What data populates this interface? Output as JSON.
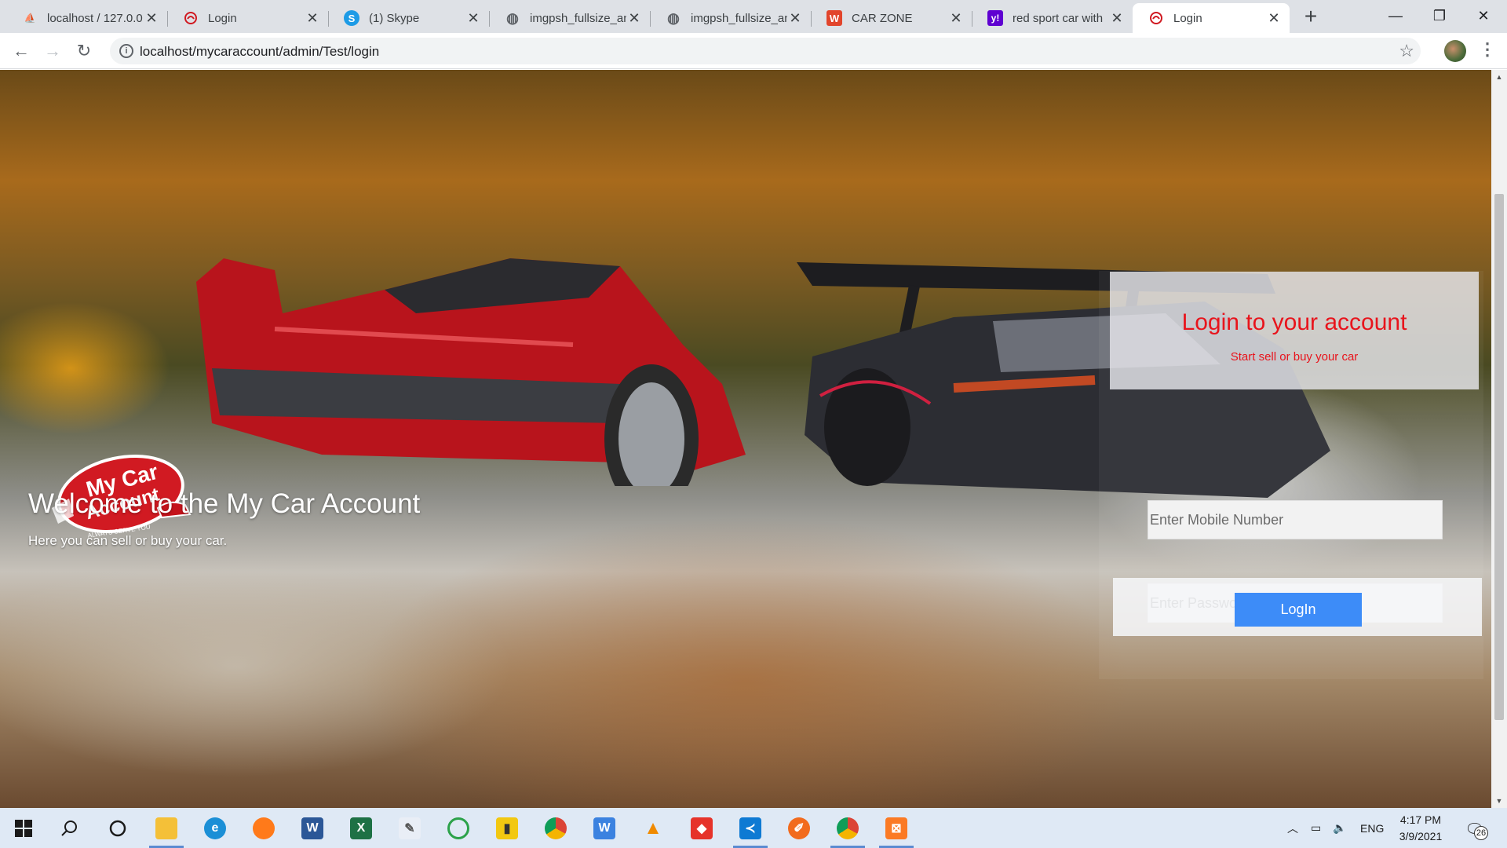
{
  "browser": {
    "tabs": [
      {
        "title": "localhost / 127.0.0",
        "favicon": "phpmyadmin-icon"
      },
      {
        "title": "Login",
        "favicon": "car-logo-icon"
      },
      {
        "title": "(1) Skype",
        "favicon": "skype-icon"
      },
      {
        "title": "imgpsh_fullsize_an",
        "favicon": "globe-icon"
      },
      {
        "title": "imgpsh_fullsize_an",
        "favicon": "globe-icon"
      },
      {
        "title": "CAR ZONE",
        "favicon": "w-brand-icon"
      },
      {
        "title": "red sport car with",
        "favicon": "yahoo-icon"
      },
      {
        "title": "Login",
        "favicon": "car-logo-icon",
        "active": true
      }
    ],
    "address": "localhost/mycaraccount/admin/Test/login"
  },
  "page": {
    "logo": {
      "line1": "My Car",
      "line2": "Account",
      "tagline": "ALWAYS SERVE YOU"
    },
    "welcome_title": "Welcome to the My Car Account",
    "welcome_subtitle": "Here you can sell or buy your car.",
    "login": {
      "title": "Login to your account",
      "subtitle": "Start sell or buy your car",
      "mobile_placeholder": "Enter Mobile Number",
      "password_placeholder": "Enter Password",
      "button_label": "LogIn"
    }
  },
  "taskbar": {
    "apps": [
      "start-icon",
      "search-icon",
      "cortana-icon",
      "file-explorer-icon",
      "edge-icon",
      "firefox-icon",
      "word-icon",
      "excel-icon",
      "paint-icon",
      "sync-icon",
      "powerbi-icon",
      "chrome-icon",
      "writer-icon",
      "vlc-icon",
      "anydesk-icon",
      "vscode-icon",
      "pen-icon",
      "chrome-profile-icon",
      "xampp-icon"
    ],
    "language": "ENG",
    "time": "4:17 PM",
    "date": "3/9/2021",
    "notifications": "26"
  },
  "colors": {
    "accent_red": "#e8141c",
    "button_blue": "#3d8cf8"
  }
}
